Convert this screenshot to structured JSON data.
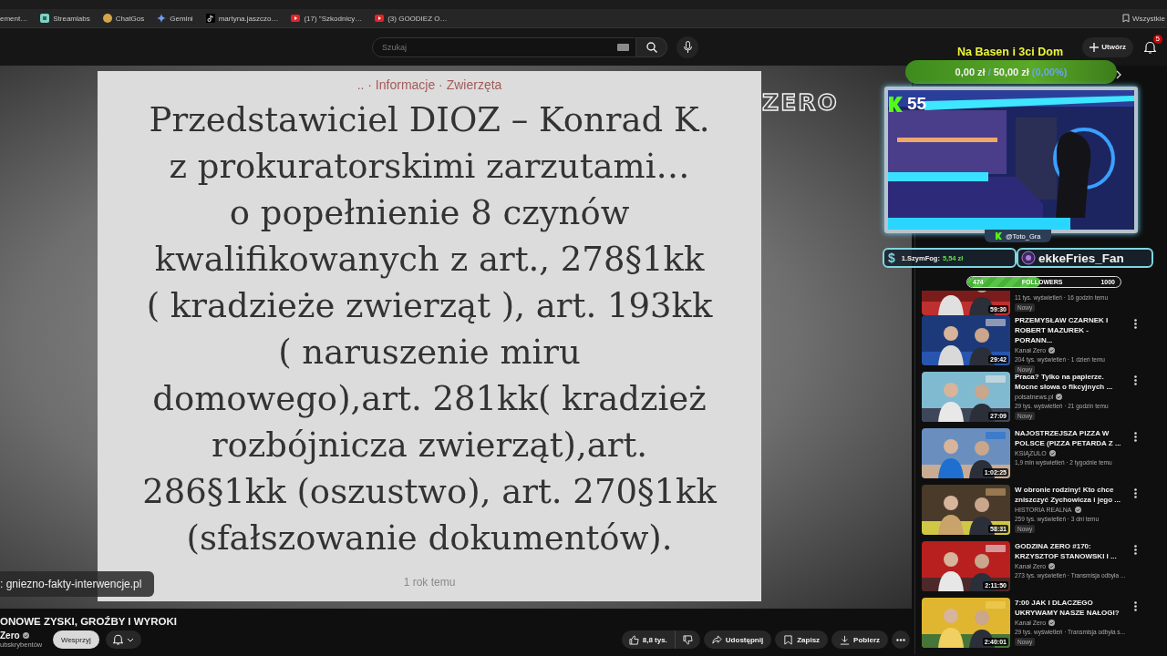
{
  "bookmarks": [
    {
      "label": "ement…",
      "kind": "none"
    },
    {
      "label": "Streamlabs",
      "kind": "square"
    },
    {
      "label": "ChatGos",
      "kind": "circle"
    },
    {
      "label": "Gemini",
      "kind": "sparkle"
    },
    {
      "label": "martyna.jaszczo…",
      "kind": "note"
    },
    {
      "label": "(17) \"Szkodnicy…",
      "kind": "play"
    },
    {
      "label": "(3) GOODIEZ O…",
      "kind": "play"
    }
  ],
  "bookmarks_folder": "Wszystkie",
  "header": {
    "search_placeholder": "Szukaj",
    "create_label": "Utwórz",
    "notification_count": "5"
  },
  "player": {
    "breadcrumb": ".. · Informacje · Zwierzęta",
    "heading": "Przedstawiciel DIOZ – Konrad K.\nz prokuratorskimi zarzutami…\no popełnienie 8 czynów\nkwalifikowanych z art., 278§1kk\n( kradzieże zwierząt ), art. 193kk\n( naruszenie miru\ndomowego),art. 281kk( kradzież\nrozbójnicza zwierząt),art.\n286§1kk (oszustwo), art. 270§1kk\n(sfałszowanie dokumentów).",
    "date": "1 rok temu",
    "logo": "ZERO",
    "source": ": gniezno-fakty-interwencje.pl"
  },
  "overlay": {
    "goal_title": "Na Basen i 3ci Dom",
    "goal_current": "0,00 zł",
    "goal_separator": "/",
    "goal_target": "50,00 zł",
    "goal_percent": "(0,00%)",
    "cam_count": "55",
    "cam_handle": "@Toto_Gra",
    "donation_icon": "$",
    "donation_name": "1.SzymFog:",
    "donation_amount": "5,54 zł",
    "follower_name": "ekkeFries_Fan",
    "followers": {
      "current": "474",
      "label": "FOLLOWERS",
      "target": "1000",
      "level": 0.474
    }
  },
  "video": {
    "title": "ONOWE ZYSKI, GROŹBY I WYROKI",
    "channel": "Zero",
    "subscribers": "ubskrybentów",
    "support": "Wesprzyj",
    "likes": "8,8 tys.",
    "actions": [
      {
        "kind": "share",
        "label": "Udostępnij"
      },
      {
        "kind": "save",
        "label": "Zapisz"
      },
      {
        "kind": "download",
        "label": "Pobierz"
      }
    ]
  },
  "sidebar": {
    "items": [
      {
        "meta": "11 tys. wyświetleń · 16 godzin temu",
        "badge": "Nowy",
        "duration": "59:30"
      },
      {
        "title": "PRZEMYSŁAW CZARNEK I ROBERT MAZUREK - PORANN...",
        "channel": "Kanał Zero",
        "verified": true,
        "meta": "204 tys. wyświetleń · 1 dzień temu",
        "badge": "Nowy",
        "duration": "29:42"
      },
      {
        "title": "Praca? Tylko na papierze. Mocne słowa o fikcyjnych ...",
        "channel": "polsatnews.pl",
        "verified": true,
        "meta": "29 tys. wyświetleń · 21 godzin temu",
        "badge": "Nowy",
        "duration": "27:09"
      },
      {
        "title": "NAJOSTRZEJSZA PIZZA W POLSCE (PIZZA PETARDA Z ...",
        "channel": "KSIĄŻULO",
        "verified": true,
        "meta": "1,9 mln wyświetleń · 2 tygodnie temu",
        "duration": "1:02:25"
      },
      {
        "title": "W obronie rodziny! Kto chce zniszczyć Zychowicza i jego ...",
        "channel": "HISTORIA REALNA",
        "verified": true,
        "meta": "259 tys. wyświetleń · 3 dni temu",
        "badge": "Nowy",
        "duration": "58:31"
      },
      {
        "title": "GODZINA ZERO #170: KRZYSZTOF STANOWSKI I ...",
        "channel": "Kanał Zero",
        "verified": true,
        "meta": "273 tys. wyświetleń · Transmisja odbyła ...",
        "duration": "2:11:50"
      },
      {
        "title": "7:00 JAK I DLACZEGO UKRYWAMY NASZE NAŁOGI?",
        "channel": "Kanał Zero",
        "verified": true,
        "meta": "29 tys. wyświetleń · Transmisja odbyła s...",
        "badge": "Nowy",
        "duration": "2:40:01"
      }
    ]
  }
}
